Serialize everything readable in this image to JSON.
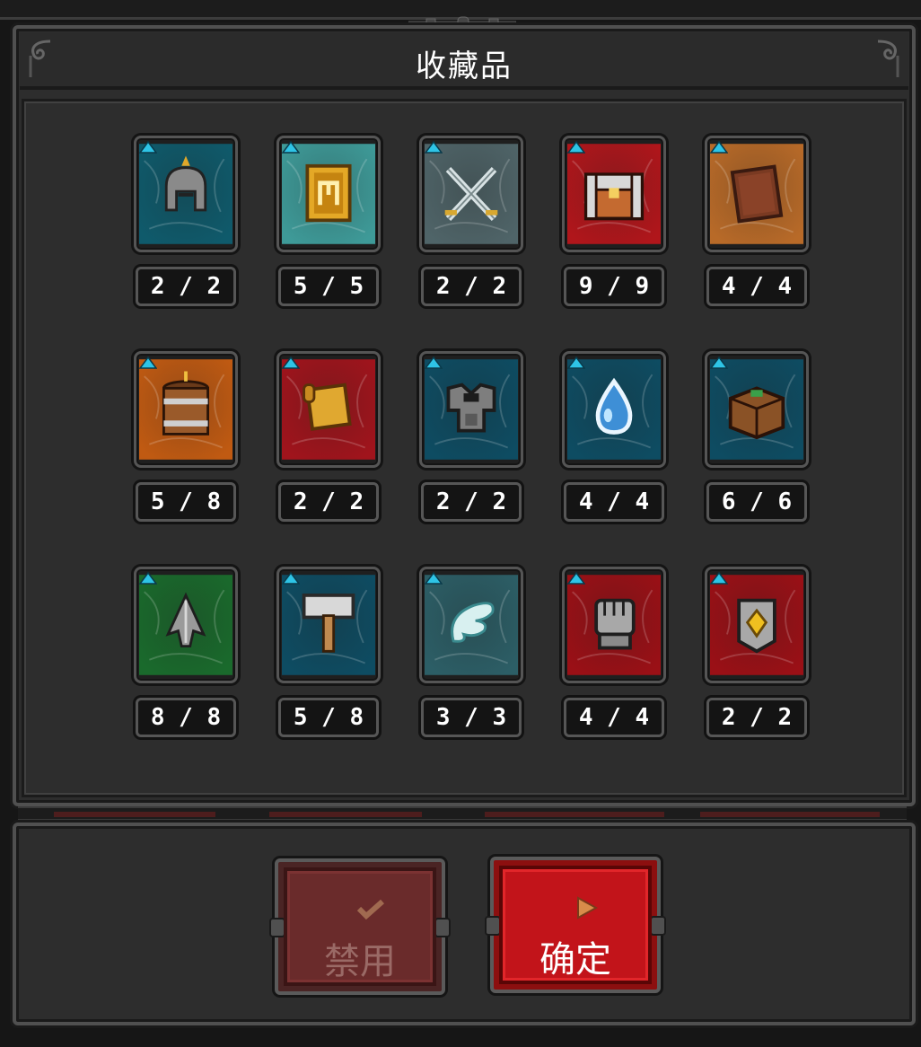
{
  "window": {
    "title": "收藏品"
  },
  "collection": {
    "items": [
      {
        "icon": "knight-helmet-icon",
        "count": "2 / 2",
        "accent": "#0f5a6b"
      },
      {
        "icon": "gold-rune-card-icon",
        "count": "5 / 5",
        "accent": "#3e9a98"
      },
      {
        "icon": "crossed-swords-icon",
        "count": "2 / 2",
        "accent": "#4f6468"
      },
      {
        "icon": "treasure-chest-icon",
        "count": "9 / 9",
        "accent": "#b0161b"
      },
      {
        "icon": "leather-book-icon",
        "count": "4 / 4",
        "accent": "#b86a28"
      },
      {
        "icon": "powder-barrel-icon",
        "count": "5 / 8",
        "accent": "#c05a12"
      },
      {
        "icon": "scroll-icon",
        "count": "2 / 2",
        "accent": "#a0141c"
      },
      {
        "icon": "iron-chestplate-icon",
        "count": "2 / 2",
        "accent": "#0e4c62"
      },
      {
        "icon": "water-drop-icon",
        "count": "4 / 4",
        "accent": "#0e4c62"
      },
      {
        "icon": "wooden-crate-icon",
        "count": "6 / 6",
        "accent": "#0e4c62"
      },
      {
        "icon": "arrowhead-icon",
        "count": "8 / 8",
        "accent": "#1a6a2c"
      },
      {
        "icon": "war-hammer-icon",
        "count": "5 / 8",
        "accent": "#0e4c62"
      },
      {
        "icon": "angel-wing-icon",
        "count": "3 / 3",
        "accent": "#2c5e66"
      },
      {
        "icon": "iron-fist-icon",
        "count": "4 / 4",
        "accent": "#9a1016"
      },
      {
        "icon": "gem-shield-icon",
        "count": "2 / 2",
        "accent": "#9a1016"
      }
    ]
  },
  "buttons": {
    "disable": {
      "label": "禁用",
      "icon": "checkmark-icon"
    },
    "confirm": {
      "label": "确定",
      "icon": "play-arrow-icon"
    }
  },
  "colors": {
    "panel": "#2d2d2d",
    "border": "#505050",
    "counter_bg": "#141414",
    "marker": "#2ec4e6",
    "confirm": "#c2141a",
    "disable": "#6a2b2b"
  }
}
